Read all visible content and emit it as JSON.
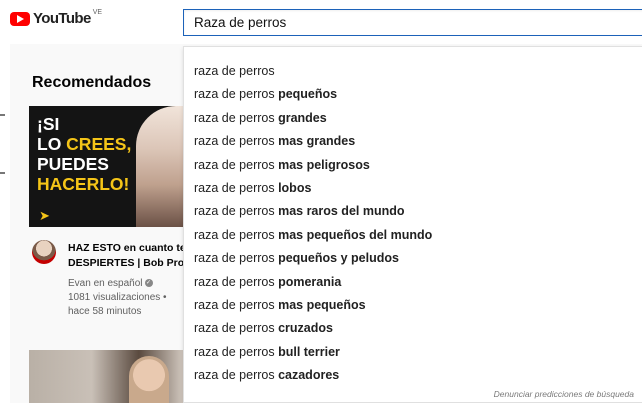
{
  "header": {
    "logo_text": "YouTube",
    "country_code": "VE",
    "search_value": "Raza de perros"
  },
  "main": {
    "section_title": "Recomendados",
    "video1": {
      "thumb_line1": "¡SI",
      "thumb_line2a": "LO ",
      "thumb_line2b": "CREES,",
      "thumb_line3": "PUEDES",
      "thumb_line4": "HACERLO!",
      "title_line1": "HAZ ESTO en cuanto te",
      "title_line2": "DESPIERTES | Bob Proc",
      "channel": "Evan en español",
      "views": "1081 visualizaciones •",
      "age": "hace 58 minutos"
    }
  },
  "suggestions": {
    "query": "raza de perros",
    "items": [
      {
        "prefix": "raza de perros",
        "suffix": ""
      },
      {
        "prefix": "raza de perros ",
        "suffix": "pequeños"
      },
      {
        "prefix": "raza de perros ",
        "suffix": "grandes"
      },
      {
        "prefix": "raza de perros ",
        "suffix": "mas grandes"
      },
      {
        "prefix": "raza de perros ",
        "suffix": "mas peligrosos"
      },
      {
        "prefix": "raza de perros ",
        "suffix": "lobos"
      },
      {
        "prefix": "raza de perros ",
        "suffix": "mas raros del mundo"
      },
      {
        "prefix": "raza de perros ",
        "suffix": "mas pequeños del mundo"
      },
      {
        "prefix": "raza de perros ",
        "suffix": "pequeños y peludos"
      },
      {
        "prefix": "raza de perros ",
        "suffix": "pomerania"
      },
      {
        "prefix": "raza de perros ",
        "suffix": "mas pequeños"
      },
      {
        "prefix": "raza de perros ",
        "suffix": "cruzados"
      },
      {
        "prefix": "raza de perros ",
        "suffix": "bull terrier"
      },
      {
        "prefix": "raza de perros ",
        "suffix": "cazadores"
      }
    ],
    "report_link": "Denunciar predicciones de búsqueda"
  },
  "colors": {
    "brand_red": "#ff0000",
    "search_border": "#1c62b9",
    "thumb_yellow": "#f5c518"
  }
}
